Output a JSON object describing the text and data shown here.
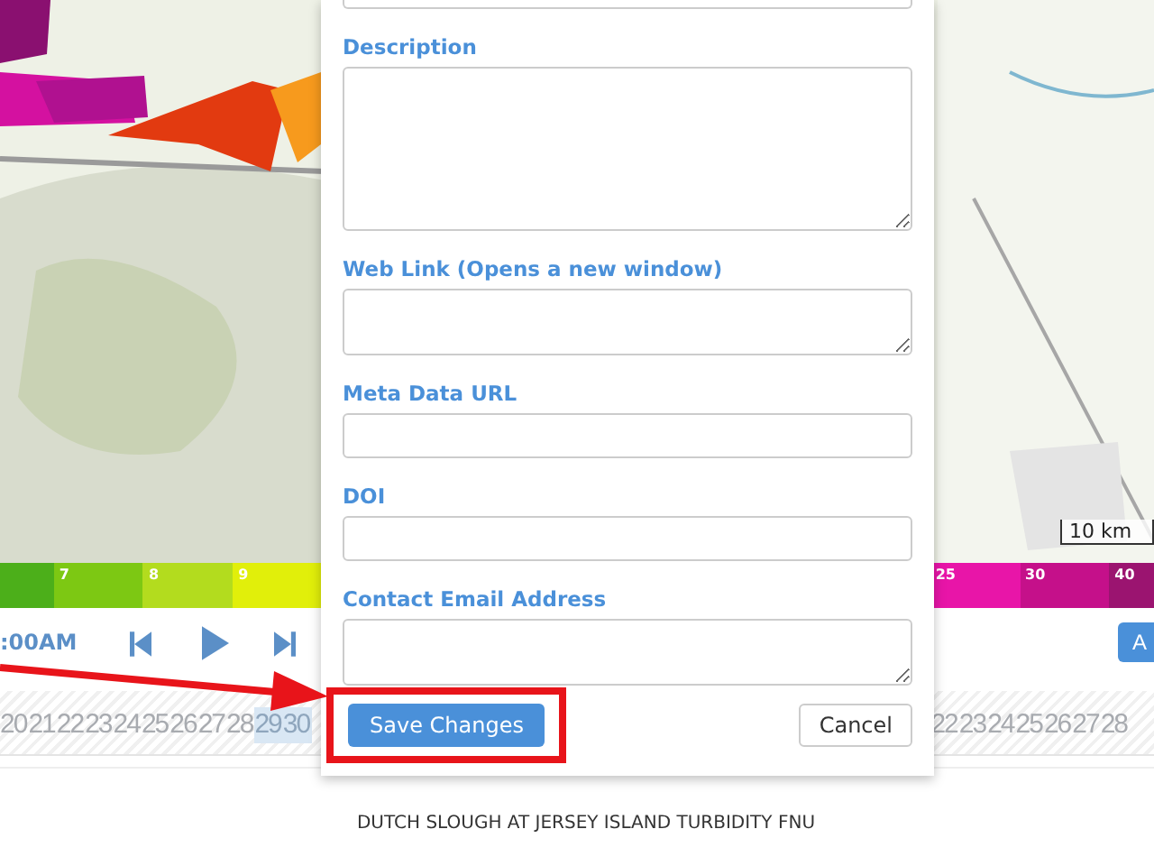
{
  "map": {
    "kind": "picture",
    "scale": "10 km"
  },
  "legend": [
    {
      "color": "#4caf1a"
    },
    {
      "label": "7",
      "color": "#7dc813"
    },
    {
      "label": "8",
      "color": "#b3dc1e"
    },
    {
      "label": "9",
      "color": "#e1ef0a"
    },
    {
      "label": "25",
      "color": "#e815a8"
    },
    {
      "label": "30",
      "color": "#c5108a"
    },
    {
      "label": "40",
      "color": "#9b1470"
    }
  ],
  "player": {
    "time": ":00AM",
    "right_button": "A"
  },
  "timeline": {
    "left_days": [
      {
        "label": "20",
        "selected": false
      },
      {
        "label": "21",
        "selected": false
      },
      {
        "label": "22",
        "selected": false
      },
      {
        "label": "23",
        "selected": false
      },
      {
        "label": "24",
        "selected": false
      },
      {
        "label": "25",
        "selected": false
      },
      {
        "label": "26",
        "selected": false
      },
      {
        "label": "27",
        "selected": false
      },
      {
        "label": "28",
        "selected": false
      },
      {
        "label": "29",
        "selected": true
      },
      {
        "label": "30",
        "selected": true
      }
    ],
    "right_days": [
      {
        "label": "22",
        "selected": false
      },
      {
        "label": "23",
        "selected": false
      },
      {
        "label": "24",
        "selected": false
      },
      {
        "label": "25",
        "selected": false
      },
      {
        "label": "26",
        "selected": false
      },
      {
        "label": "27",
        "selected": false
      },
      {
        "label": "28",
        "selected": false
      }
    ]
  },
  "chart_title": "DUTCH SLOUGH AT JERSEY ISLAND TURBIDITY FNU",
  "dialog": {
    "fields": [
      {
        "label": "Description",
        "kind": "large_textarea"
      },
      {
        "label": "Web Link (Opens a new window)",
        "kind": "textarea"
      },
      {
        "label": "Meta Data URL",
        "kind": "input"
      },
      {
        "label": "DOI",
        "kind": "input"
      },
      {
        "label": "Contact Email Address",
        "kind": "textarea"
      }
    ],
    "save_button": {
      "label": "Save Changes",
      "highlighted": true
    },
    "cancel_button": "Cancel"
  }
}
